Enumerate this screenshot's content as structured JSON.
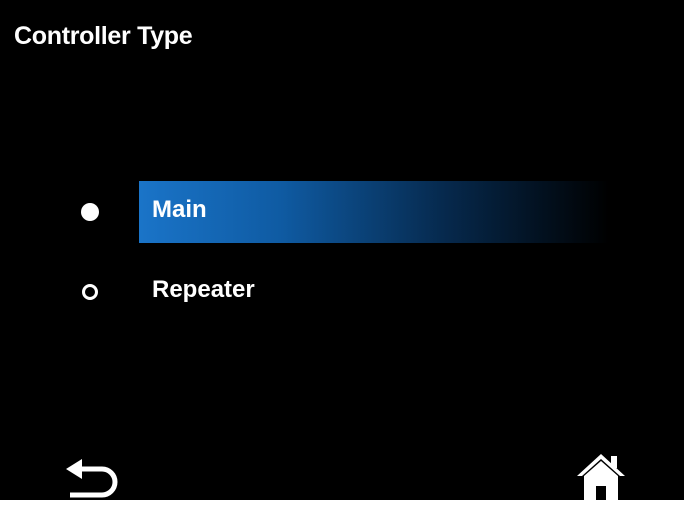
{
  "screen": {
    "title": "Controller Type"
  },
  "options": [
    {
      "label": "Main",
      "selected": true
    },
    {
      "label": "Repeater",
      "selected": false
    }
  ],
  "footer": {
    "back_icon": "back-arrow-icon",
    "home_icon": "home-icon"
  },
  "colors": {
    "background": "#000000",
    "text": "#ffffff",
    "selection_accent": "#1a74c8"
  }
}
